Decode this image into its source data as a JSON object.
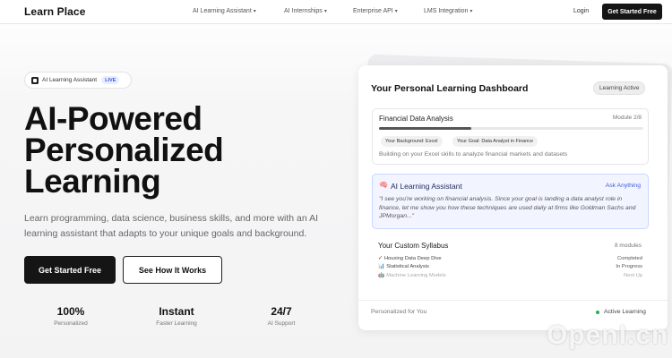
{
  "nav": {
    "brand": "Learn Place",
    "links": [
      {
        "label": "AI Learning Assistant",
        "caret": "▾"
      },
      {
        "label": "AI Internships",
        "caret": "▾"
      },
      {
        "label": "Enterprise API",
        "caret": "▾"
      },
      {
        "label": "LMS Integration",
        "caret": "▾"
      }
    ],
    "login": "Login",
    "cta": "Get Started Free"
  },
  "hero": {
    "pill_text": "AI Learning Assistant",
    "pill_badge": "LIVE",
    "title_lines": [
      "AI-Powered",
      "Personalized",
      "Learning"
    ],
    "subtitle": "Learn programming, data science, business skills, and more with an AI learning assistant that adapts to your unique goals and background.",
    "primary_button": "Get Started Free",
    "secondary_button": "See How It Works",
    "stats": [
      {
        "value": "100%",
        "label": "Personalized"
      },
      {
        "value": "Instant",
        "label": "Faster Learning"
      },
      {
        "value": "24/7",
        "label": "AI Support"
      }
    ]
  },
  "dashboard": {
    "title": "Your Personal Learning Dashboard",
    "status_badge": "Learning Active",
    "module": {
      "name": "Financial Data Analysis",
      "counter": "Module 2/8",
      "progress": 0.35,
      "tags": [
        "Your Background: Excel",
        "Your Goal: Data Analyst in Finance"
      ],
      "description": "Building on your Excel skills to analyze financial markets and datasets"
    },
    "assistant": {
      "icon": "🧠",
      "name": "AI Learning Assistant",
      "action": "Ask Anything",
      "quote": "\"I see you're working on financial analysis. Since your goal is landing a data analyst role in finance, let me show you how these techniques are used daily at firms like Goldman Sachs and JPMorgan...\""
    },
    "syllabus": {
      "title": "Your Custom Syllabus",
      "count": "8 modules",
      "items": [
        {
          "icon": "✓",
          "name": "Housing Data Deep Dive",
          "status": "Completed"
        },
        {
          "icon": "📊",
          "name": "Statistical Analysis",
          "status": "In Progress"
        },
        {
          "icon": "🤖",
          "name": "Machine Learning Models",
          "status": "Next Up"
        }
      ]
    },
    "footer_left": "Personalized for You",
    "footer_right": "Active Learning",
    "colors": {
      "active_dot": "#22b14c",
      "accent": "#3b5bdb"
    }
  },
  "watermark": "OpenI.cn"
}
